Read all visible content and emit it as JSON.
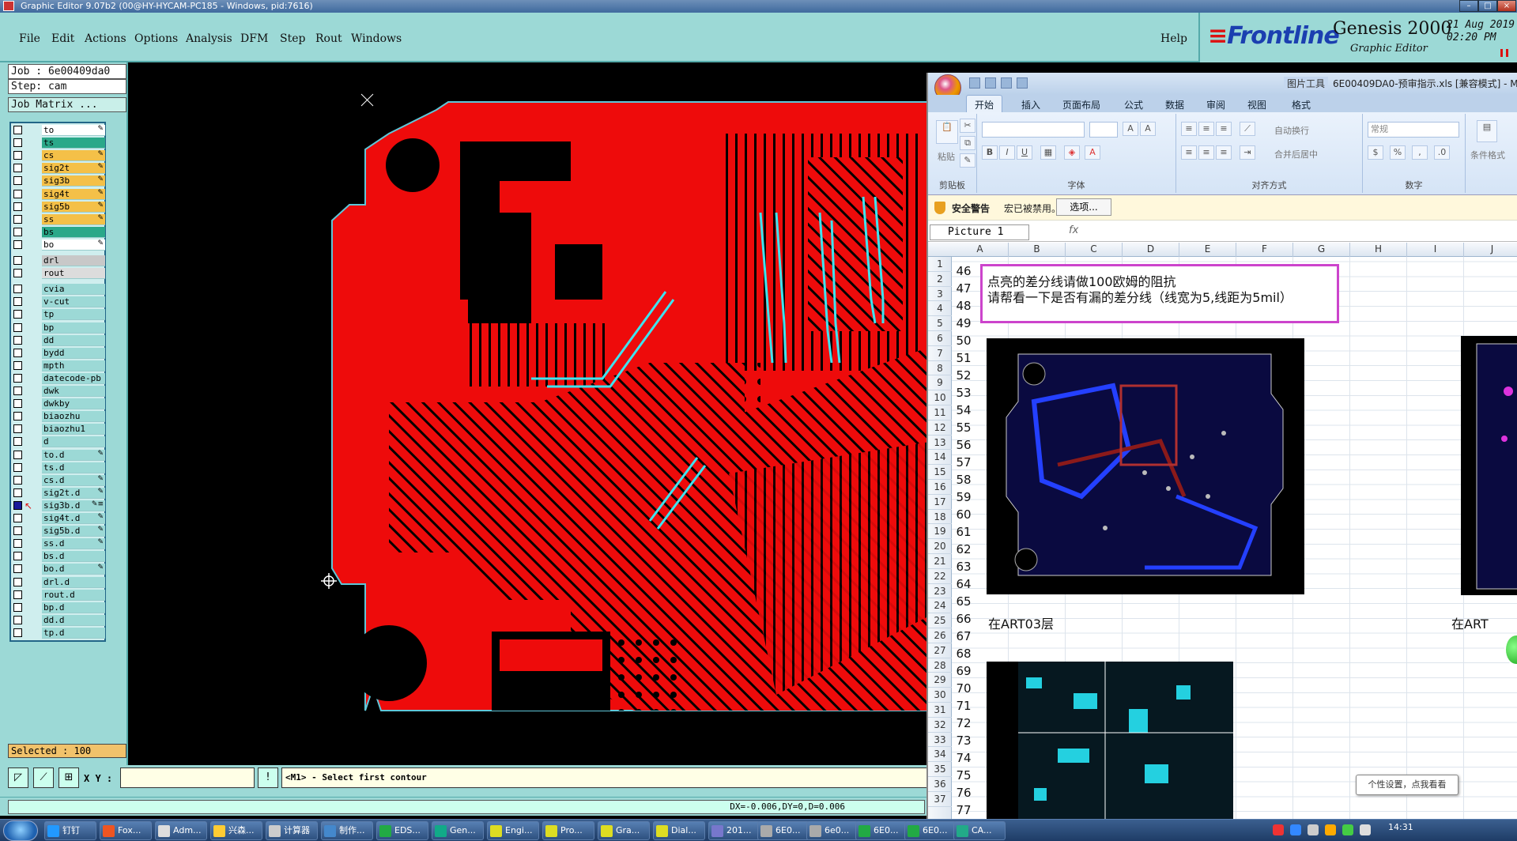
{
  "window": {
    "title": "Graphic Editor 9.07b2 (00@HY-HYCAM-PC185 - Windows, pid:7616)"
  },
  "menu": {
    "items": [
      "File",
      "Edit",
      "Actions",
      "Options",
      "Analysis",
      "DFM",
      "Step",
      "Rout",
      "Windows"
    ],
    "help": "Help"
  },
  "logo": {
    "brand": "Frontline",
    "product": "Genesis 2000",
    "subtitle": "Graphic Editor",
    "date": "21 Aug 2019",
    "time": "02:20 PM"
  },
  "job": {
    "job_label": "Job : 6e00409da0",
    "step_label": "Step: cam",
    "matrix_button": "Job Matrix ..."
  },
  "layers": [
    {
      "name": "to",
      "color": "#ffffff",
      "tag": "✎"
    },
    {
      "name": "ts",
      "color": "#2aa889",
      "tag": ""
    },
    {
      "name": "cs",
      "color": "#f4c048",
      "tag": "✎"
    },
    {
      "name": "sig2t",
      "color": "#f4c048",
      "tag": "✎"
    },
    {
      "name": "sig3b",
      "color": "#f4c048",
      "tag": "✎"
    },
    {
      "name": "sig4t",
      "color": "#f4c048",
      "tag": "✎"
    },
    {
      "name": "sig5b",
      "color": "#f4c048",
      "tag": "✎"
    },
    {
      "name": "ss",
      "color": "#f4c048",
      "tag": "✎"
    },
    {
      "name": "bs",
      "color": "#2aa889",
      "tag": ""
    },
    {
      "name": "bo",
      "color": "#ffffff",
      "tag": "✎"
    },
    {
      "name": "drl",
      "color": "#c8c8c8",
      "tag": "",
      "gap": true
    },
    {
      "name": "rout",
      "color": "#dcdcdc",
      "tag": ""
    },
    {
      "name": "cvia",
      "color": "#9cd9d6",
      "tag": "",
      "gap": true
    },
    {
      "name": "v-cut",
      "color": "#9cd9d6",
      "tag": ""
    },
    {
      "name": "tp",
      "color": "#9cd9d6",
      "tag": ""
    },
    {
      "name": "bp",
      "color": "#9cd9d6",
      "tag": ""
    },
    {
      "name": "dd",
      "color": "#9cd9d6",
      "tag": ""
    },
    {
      "name": "bydd",
      "color": "#9cd9d6",
      "tag": ""
    },
    {
      "name": "mpth",
      "color": "#9cd9d6",
      "tag": ""
    },
    {
      "name": "datecode-pb",
      "color": "#9cd9d6",
      "tag": ""
    },
    {
      "name": "dwk",
      "color": "#9cd9d6",
      "tag": ""
    },
    {
      "name": "dwkby",
      "color": "#9cd9d6",
      "tag": ""
    },
    {
      "name": "biaozhu",
      "color": "#9cd9d6",
      "tag": ""
    },
    {
      "name": "biaozhu1",
      "color": "#9cd9d6",
      "tag": ""
    },
    {
      "name": "d",
      "color": "#9cd9d6",
      "tag": ""
    },
    {
      "name": "to.d",
      "color": "#9cd9d6",
      "tag": "✎"
    },
    {
      "name": "ts.d",
      "color": "#9cd9d6",
      "tag": ""
    },
    {
      "name": "cs.d",
      "color": "#9cd9d6",
      "tag": "✎"
    },
    {
      "name": "sig2t.d",
      "color": "#9cd9d6",
      "tag": "✎"
    },
    {
      "name": "sig3b.d",
      "color": "#9cd9d6",
      "tag": "✎≡",
      "active": true
    },
    {
      "name": "sig4t.d",
      "color": "#9cd9d6",
      "tag": "✎"
    },
    {
      "name": "sig5b.d",
      "color": "#9cd9d6",
      "tag": "✎"
    },
    {
      "name": "ss.d",
      "color": "#9cd9d6",
      "tag": "✎"
    },
    {
      "name": "bs.d",
      "color": "#9cd9d6",
      "tag": ""
    },
    {
      "name": "bo.d",
      "color": "#9cd9d6",
      "tag": "✎"
    },
    {
      "name": "drl.d",
      "color": "#9cd9d6",
      "tag": ""
    },
    {
      "name": "rout.d",
      "color": "#9cd9d6",
      "tag": ""
    },
    {
      "name": "bp.d",
      "color": "#9cd9d6",
      "tag": ""
    },
    {
      "name": "dd.d",
      "color": "#9cd9d6",
      "tag": ""
    },
    {
      "name": "tp.d",
      "color": "#9cd9d6",
      "tag": ""
    }
  ],
  "selected_label": "Selected : 100",
  "bottom": {
    "xy_label": "X Y :",
    "xy_value": "",
    "prompt": "<M1> - Select first contour",
    "status": "DX=-0.006,DY=0,D=0.006"
  },
  "excel": {
    "picture_tools": "图片工具",
    "filename": "6E00409DA0-预审指示.xls [兼容模式] - M",
    "tabs": [
      "开始",
      "插入",
      "页面布局",
      "公式",
      "数据",
      "审阅",
      "视图",
      "格式"
    ],
    "groups": {
      "clipboard": "剪贴板",
      "font": "字体",
      "align": "对齐方式",
      "number": "数字",
      "paste": "粘贴",
      "wrap": "自动换行",
      "merge": "合并后居中",
      "general": "常规",
      "cond": "条件格式"
    },
    "security": {
      "title": "安全警告",
      "text": "宏已被禁用。",
      "button": "选项..."
    },
    "namebox": "Picture 1",
    "fx": "fx",
    "columns": [
      "A",
      "B",
      "C",
      "D",
      "E",
      "F",
      "G",
      "H",
      "I",
      "J"
    ],
    "rows": [
      "1",
      "2",
      "3",
      "4",
      "5",
      "6",
      "7",
      "8",
      "9",
      "10",
      "11",
      "12",
      "13",
      "14",
      "15",
      "16",
      "17",
      "18",
      "19",
      "20",
      "21",
      "22",
      "23",
      "24",
      "25",
      "26",
      "27",
      "28",
      "29",
      "30",
      "31",
      "32",
      "33",
      "34",
      "35",
      "36",
      "37"
    ],
    "col_a": [
      "46",
      "47",
      "48",
      "49",
      "50",
      "51",
      "52",
      "53",
      "54",
      "55",
      "56",
      "57",
      "58",
      "59",
      "60",
      "61",
      "62",
      "63",
      "64",
      "65",
      "66",
      "67",
      "68",
      "69",
      "70",
      "71",
      "72",
      "73",
      "74",
      "75",
      "76",
      "77"
    ],
    "note_line1": "点亮的差分线请做100欧姆的阻抗",
    "note_line2": "请帮看一下是否有漏的差分线（线宽为5,线距为5mil）",
    "caption1": "在ART03层",
    "caption2": "在ART"
  },
  "ime_balloon": "个性设置，点我看看",
  "taskbar": {
    "items": [
      "钉钉",
      "Fox...",
      "Adm...",
      "兴森...",
      "计算器",
      "制作...",
      "EDS...",
      "Gen...",
      "Engi...",
      "Pro...",
      "Gra...",
      "Dial...",
      "201...",
      "6E0...",
      "6e0...",
      "6E0...",
      "6E0...",
      "CA..."
    ],
    "clock": "14:31"
  }
}
